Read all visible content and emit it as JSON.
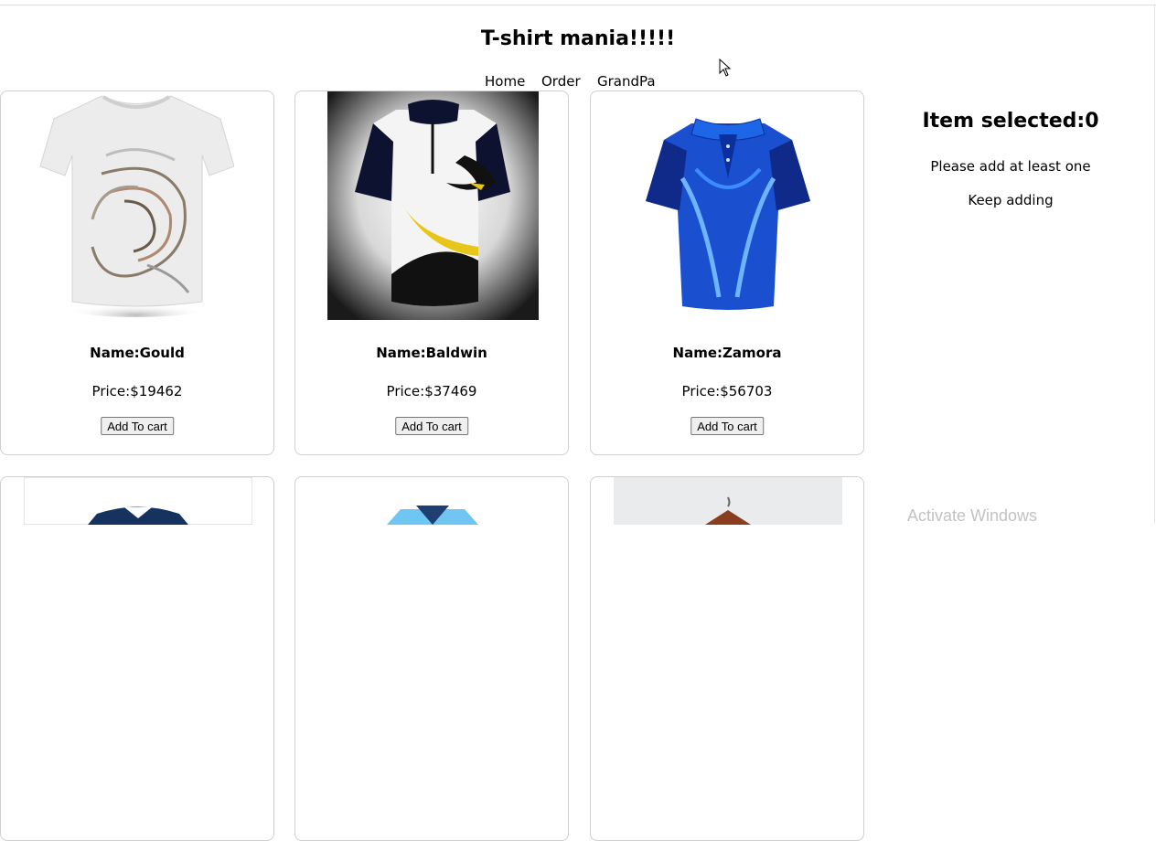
{
  "page": {
    "title": "T-shirt mania!!!!!"
  },
  "nav": {
    "items": [
      "Home",
      "Order",
      "GrandPa"
    ]
  },
  "products": [
    {
      "name": "Name:Gould",
      "price": "Price:$19462",
      "button": "Add To cart",
      "image": "white-graphic-tshirt"
    },
    {
      "name": "Name:Baldwin",
      "price": "Price:$37469",
      "button": "Add To cart",
      "image": "white-black-yellow-jersey"
    },
    {
      "name": "Name:Zamora",
      "price": "Price:$56703",
      "button": "Add To cart",
      "image": "blue-polo-shirt"
    }
  ],
  "partial_products": [
    {
      "image": "navy-polo-shirt"
    },
    {
      "image": "light-blue-jersey"
    },
    {
      "image": "shirt-on-hanger"
    }
  ],
  "cart": {
    "heading": "Item selected:0",
    "line1": "Please add at least one",
    "line2": "Keep adding"
  },
  "watermark": "Activate Windows",
  "icons": {
    "cursor": "mouse-pointer-icon"
  }
}
